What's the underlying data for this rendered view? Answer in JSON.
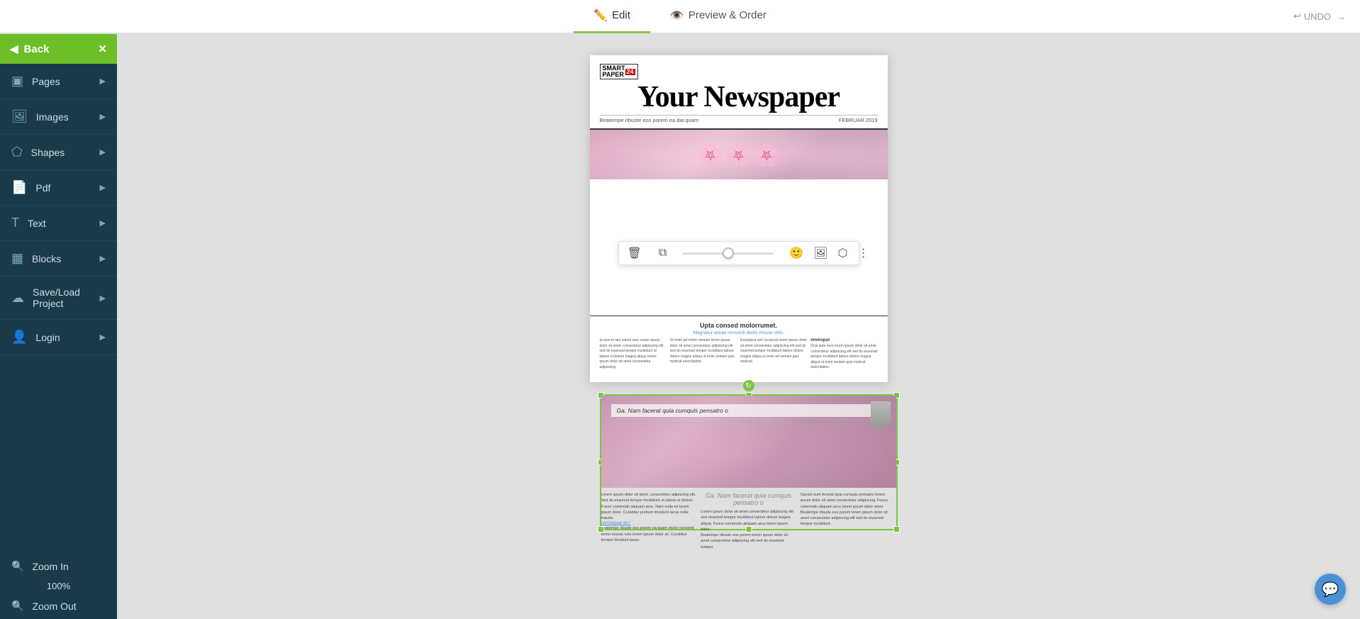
{
  "topbar": {
    "tabs": [
      {
        "id": "edit",
        "label": "Edit",
        "icon": "✏️",
        "active": true
      },
      {
        "id": "preview",
        "label": "Preview & Order",
        "icon": "👁️",
        "active": false
      }
    ],
    "undo_label": "UNDO",
    "redo_icon": "→"
  },
  "sidebar": {
    "back_label": "Back",
    "back_icon": "←",
    "close_icon": "✕",
    "items": [
      {
        "id": "pages",
        "label": "Pages",
        "icon": "□"
      },
      {
        "id": "images",
        "label": "Images",
        "icon": "🖼"
      },
      {
        "id": "shapes",
        "label": "Shapes",
        "icon": "⬠"
      },
      {
        "id": "pdf",
        "label": "Pdf",
        "icon": "📄"
      },
      {
        "id": "text",
        "label": "Text",
        "icon": "T"
      },
      {
        "id": "blocks",
        "label": "Blocks",
        "icon": "▦"
      },
      {
        "id": "saveload",
        "label": "Save/Load Project",
        "icon": "☁"
      },
      {
        "id": "login",
        "label": "Login",
        "icon": "👤"
      }
    ],
    "zoom_in_label": "Zoom In",
    "zoom_value": "100%",
    "zoom_out_label": "Zoom Out",
    "zoom_icon": "🔍"
  },
  "newspaper": {
    "logo_text": "SMART PAPER",
    "logo_number": "24",
    "title": "Your Newspaper",
    "subtitle_left": "Beatempe ribuste eos porem ea dia quam",
    "subtitle_right": "FEBRUAR 2019",
    "banner_alt": "Cherry blossom photo banner",
    "headline_text": "Ga. Nam facerat quia cumquis pensatro o",
    "link_text": "nonsequae en.*",
    "bottom_section_title": "Upta consed molorrumet.",
    "bottom_section_subtitle": "Magnatur accae nonsenti demo mosse volu.",
    "bottom_col1_title": "",
    "bottom_col2_title": "",
    "bottom_col3_title": "nmmspur"
  },
  "toolbar": {
    "delete_icon": "🗑",
    "layers_icon": "⧉",
    "emoji_icon": "🙂",
    "image_icon": "🖼",
    "shape_icon": "⬡",
    "more_icon": "⋮",
    "slider_value": 50
  },
  "chat": {
    "icon": "💬"
  }
}
